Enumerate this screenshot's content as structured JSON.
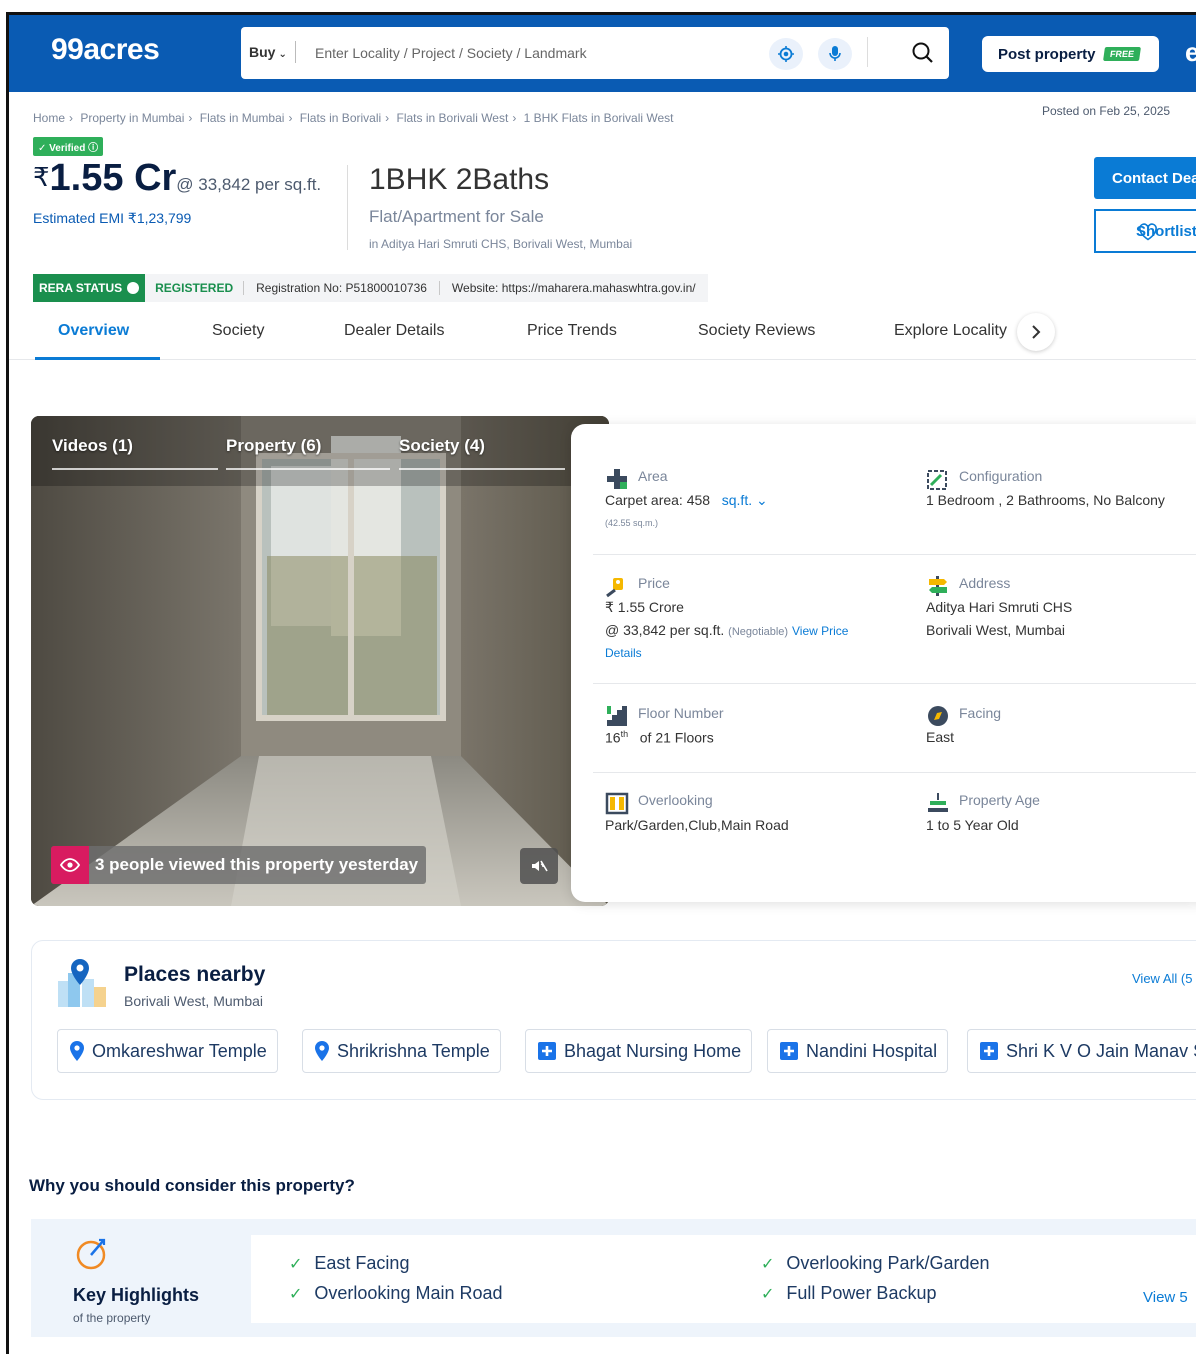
{
  "header": {
    "logo": "99acres",
    "buy_label": "Buy",
    "search_placeholder": "Enter Locality / Project / Society / Landmark",
    "post_label": "Post property",
    "free_badge": "FREE"
  },
  "breadcrumb": [
    "Home",
    "Property in Mumbai",
    "Flats in Mumbai",
    "Flats in Borivali",
    "Flats in Borivali West",
    "1 BHK Flats in Borivali West"
  ],
  "posted": "Posted on Feb 25, 2025",
  "listing": {
    "verified": "Verified",
    "currency": "₹",
    "price": "1.55 Cr",
    "per_sqft": "@ 33,842 per sq.ft.",
    "emi": "Estimated EMI ₹1,23,799",
    "title": "1BHK 2Baths",
    "subtitle": "Flat/Apartment for Sale",
    "location": "in Aditya Hari Smruti CHS, Borivali West, Mumbai",
    "contact_label": "Contact Dealer",
    "shortlist_label": "Shortlist"
  },
  "rera": {
    "badge": "RERA STATUS",
    "status": "REGISTERED",
    "registration": "Registration No: P51800010736",
    "website": "Website: https://maharera.mahaswhtra.gov.in/"
  },
  "tabs": [
    "Overview",
    "Society",
    "Dealer Details",
    "Price Trends",
    "Society Reviews",
    "Explore Locality"
  ],
  "photo": {
    "tabs": [
      "Videos (1)",
      "Property (6)",
      "Society (4)"
    ],
    "views": "3 people viewed this property yesterday"
  },
  "details": {
    "area": {
      "label": "Area",
      "value": "Carpet area: 458",
      "unit": "sq.ft.",
      "sub": "(42.55 sq.m.)"
    },
    "configuration": {
      "label": "Configuration",
      "value": "1 Bedroom , 2 Bathrooms, No Balcony"
    },
    "price": {
      "label": "Price",
      "value": "₹ 1.55 Crore",
      "per": "@ 33,842 per sq.ft.",
      "negotiable": "(Negotiable)",
      "link1": "View Price",
      "link2": "Details"
    },
    "address": {
      "label": "Address",
      "line1": "Aditya Hari Smruti CHS",
      "line2": "Borivali West, Mumbai"
    },
    "floor": {
      "label": "Floor Number",
      "value": "16",
      "sup": "th",
      "total": "of 21 Floors"
    },
    "facing": {
      "label": "Facing",
      "value": "East"
    },
    "overlooking": {
      "label": "Overlooking",
      "value": "Park/Garden,Club,Main Road"
    },
    "age": {
      "label": "Property Age",
      "value": "1 to 5 Year Old"
    }
  },
  "places": {
    "title": "Places nearby",
    "subtitle": "Borivali West, Mumbai",
    "view_all": "View All (5",
    "items": [
      {
        "name": "Omkareshwar Temple",
        "icon": "location-pin-icon"
      },
      {
        "name": "Shrikrishna Temple",
        "icon": "location-pin-icon"
      },
      {
        "name": "Bhagat Nursing Home",
        "icon": "hospital-cross-icon"
      },
      {
        "name": "Nandini Hospital",
        "icon": "hospital-cross-icon"
      },
      {
        "name": "Shri K V O Jain Manav S",
        "icon": "hospital-cross-icon"
      }
    ]
  },
  "why": {
    "heading": "Why you should consider this property?",
    "title": "Key Highlights",
    "subtitle": "of the property",
    "items": [
      "East Facing",
      "Overlooking Main Road",
      "Overlooking Park/Garden",
      "Full Power Backup"
    ],
    "view_more": "View 5"
  },
  "colors": {
    "brand": "#0A5BB3",
    "accent": "#0A7BD5",
    "success": "#2FAF5A",
    "pink": "#D81B60"
  }
}
